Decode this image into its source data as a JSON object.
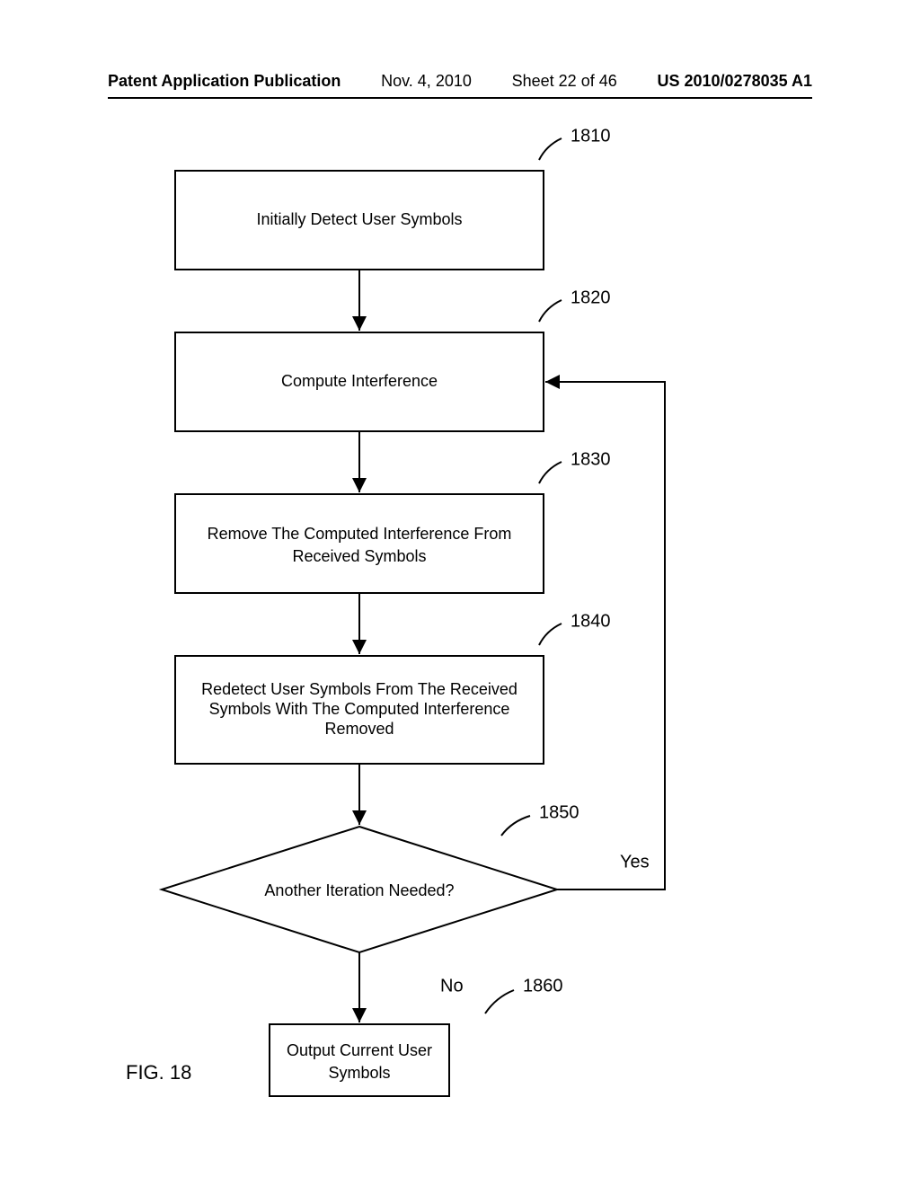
{
  "header": {
    "publication": "Patent Application Publication",
    "date": "Nov. 4, 2010",
    "sheet": "Sheet 22 of 46",
    "docnum": "US 2010/0278035 A1"
  },
  "flowchart": {
    "figure_label": "FIG. 18",
    "boxes": {
      "b1810": {
        "ref": "1810",
        "line1": "Initially Detect User Symbols"
      },
      "b1820": {
        "ref": "1820",
        "line1": "Compute Interference"
      },
      "b1830": {
        "ref": "1830",
        "line1": "Remove The Computed Interference From",
        "line2": "Received Symbols"
      },
      "b1840": {
        "ref": "1840",
        "line1": "Redetect User Symbols From The Received",
        "line2": "Symbols With The Computed Interference",
        "line3": "Removed"
      },
      "b1850": {
        "ref": "1850",
        "line1": "Another Iteration Needed?"
      },
      "b1860": {
        "ref": "1860",
        "line1": "Output Current User",
        "line2": "Symbols"
      }
    },
    "edges": {
      "yes": "Yes",
      "no": "No"
    }
  }
}
